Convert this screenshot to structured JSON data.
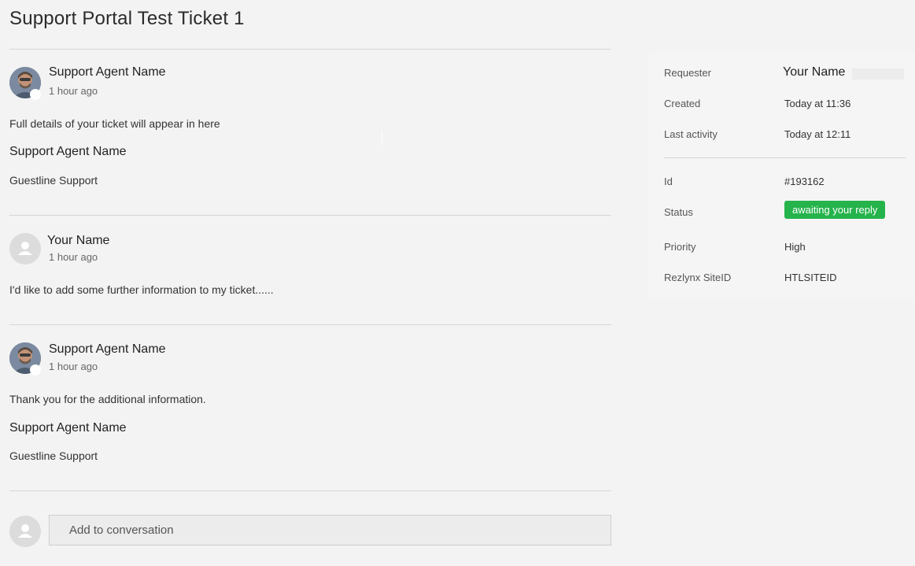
{
  "ticket": {
    "title": "Support Portal Test Ticket 1"
  },
  "comments": [
    {
      "author": "Support Agent Name",
      "time": "1 hour ago",
      "body": "Full details of your ticket will appear in here",
      "signature_name": "Support Agent Name",
      "signature_org": "Guestline Support",
      "avatar": "agent-photo-avatar"
    },
    {
      "author": "Your Name",
      "time": "1 hour ago",
      "body": "I'd like to add some further information to my ticket......",
      "avatar": "default-user-avatar"
    },
    {
      "author": "Support Agent Name",
      "time": "1 hour ago",
      "body": "Thank you for the additional information.",
      "signature_name": "Support Agent Name",
      "signature_org": "Guestline Support",
      "avatar": "agent-photo-avatar"
    }
  ],
  "reply": {
    "placeholder": "Add to conversation",
    "avatar": "default-user-avatar"
  },
  "sidebar": {
    "requester_label": "Requester",
    "requester_value": "Your Name",
    "created_label": "Created",
    "created_value": "Today at 11:36",
    "last_activity_label": "Last activity",
    "last_activity_value": "Today at 12:11",
    "id_label": "Id",
    "id_value": "#193162",
    "status_label": "Status",
    "status_value": "awaiting your reply",
    "priority_label": "Priority",
    "priority_value": "High",
    "site_label": "Rezlynx SiteID",
    "site_value": "HTLSITEID"
  },
  "colors": {
    "status_badge": "#25b34b",
    "background": "#f3f3f3",
    "sidebar_background": "#f5f5f5"
  },
  "icons": {
    "default_avatar": "user-silhouette-icon"
  }
}
